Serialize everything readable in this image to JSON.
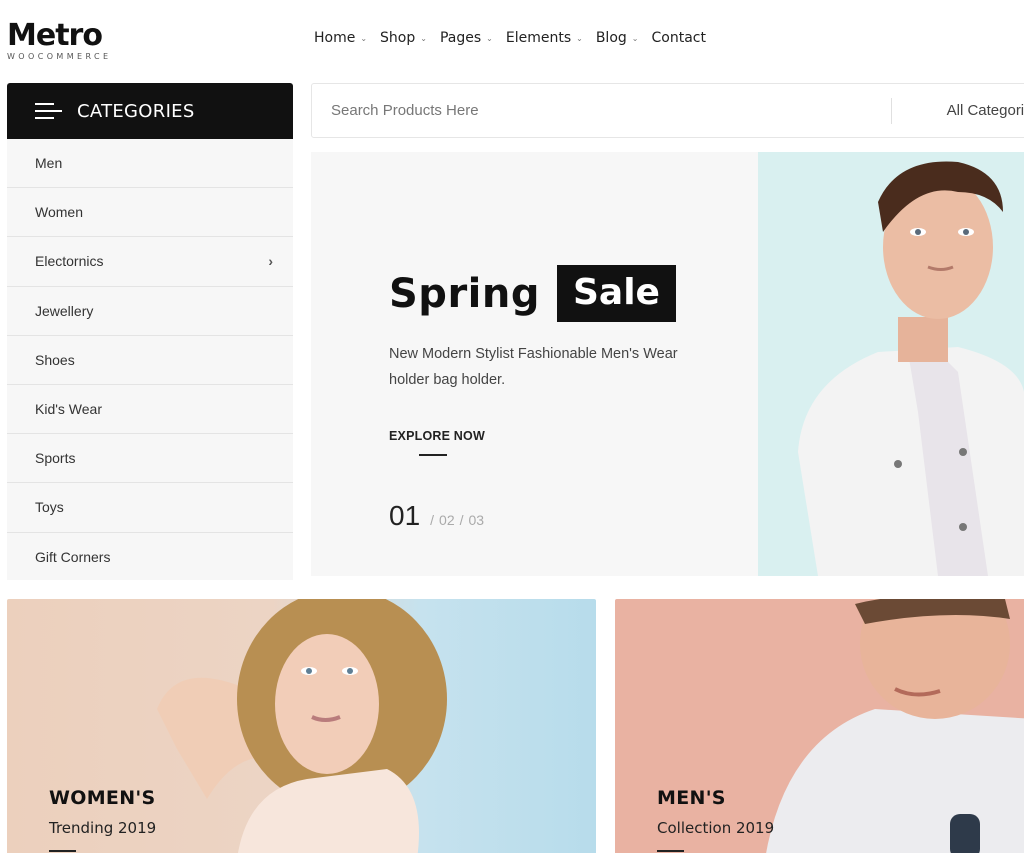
{
  "brand": {
    "name": "Metro",
    "tagline": "WOOCOMMERCE"
  },
  "nav": {
    "items": [
      {
        "label": "Home",
        "has_dropdown": true
      },
      {
        "label": "Shop",
        "has_dropdown": true
      },
      {
        "label": "Pages",
        "has_dropdown": true
      },
      {
        "label": "Elements",
        "has_dropdown": true
      },
      {
        "label": "Blog",
        "has_dropdown": true
      },
      {
        "label": "Contact",
        "has_dropdown": false
      }
    ],
    "dropdown_glyph": "⌄"
  },
  "categories": {
    "title": "CATEGORIES",
    "items": [
      {
        "label": "Men"
      },
      {
        "label": "Women"
      },
      {
        "label": "Electornics",
        "has_submenu": true
      },
      {
        "label": "Jewellery"
      },
      {
        "label": "Shoes"
      },
      {
        "label": "Kid's Wear"
      },
      {
        "label": "Sports"
      },
      {
        "label": "Toys"
      },
      {
        "label": "Gift Corners"
      }
    ],
    "submenu_glyph": "›"
  },
  "search": {
    "placeholder": "Search Products Here",
    "value": "",
    "category_select": "All Categories"
  },
  "hero": {
    "title_plain": "Spring",
    "title_highlight": "Sale",
    "description": "New Modern Stylist Fashionable Men's Wear holder bag holder.",
    "cta_label": "EXPLORE NOW",
    "pager": {
      "current": "01",
      "separator": "/",
      "others": [
        "02",
        "03"
      ]
    }
  },
  "banners": [
    {
      "title": "WOMEN'S",
      "subtitle": "Trending 2019"
    },
    {
      "title": "MEN'S",
      "subtitle": "Collection 2019"
    }
  ],
  "colors": {
    "primary_dark": "#111111",
    "panel_bg": "#f7f7f7",
    "hero_image_bg": "#d9f0f0",
    "women_banner_bg": "#ecd0bd",
    "men_banner_bg": "#e9b2a2"
  }
}
